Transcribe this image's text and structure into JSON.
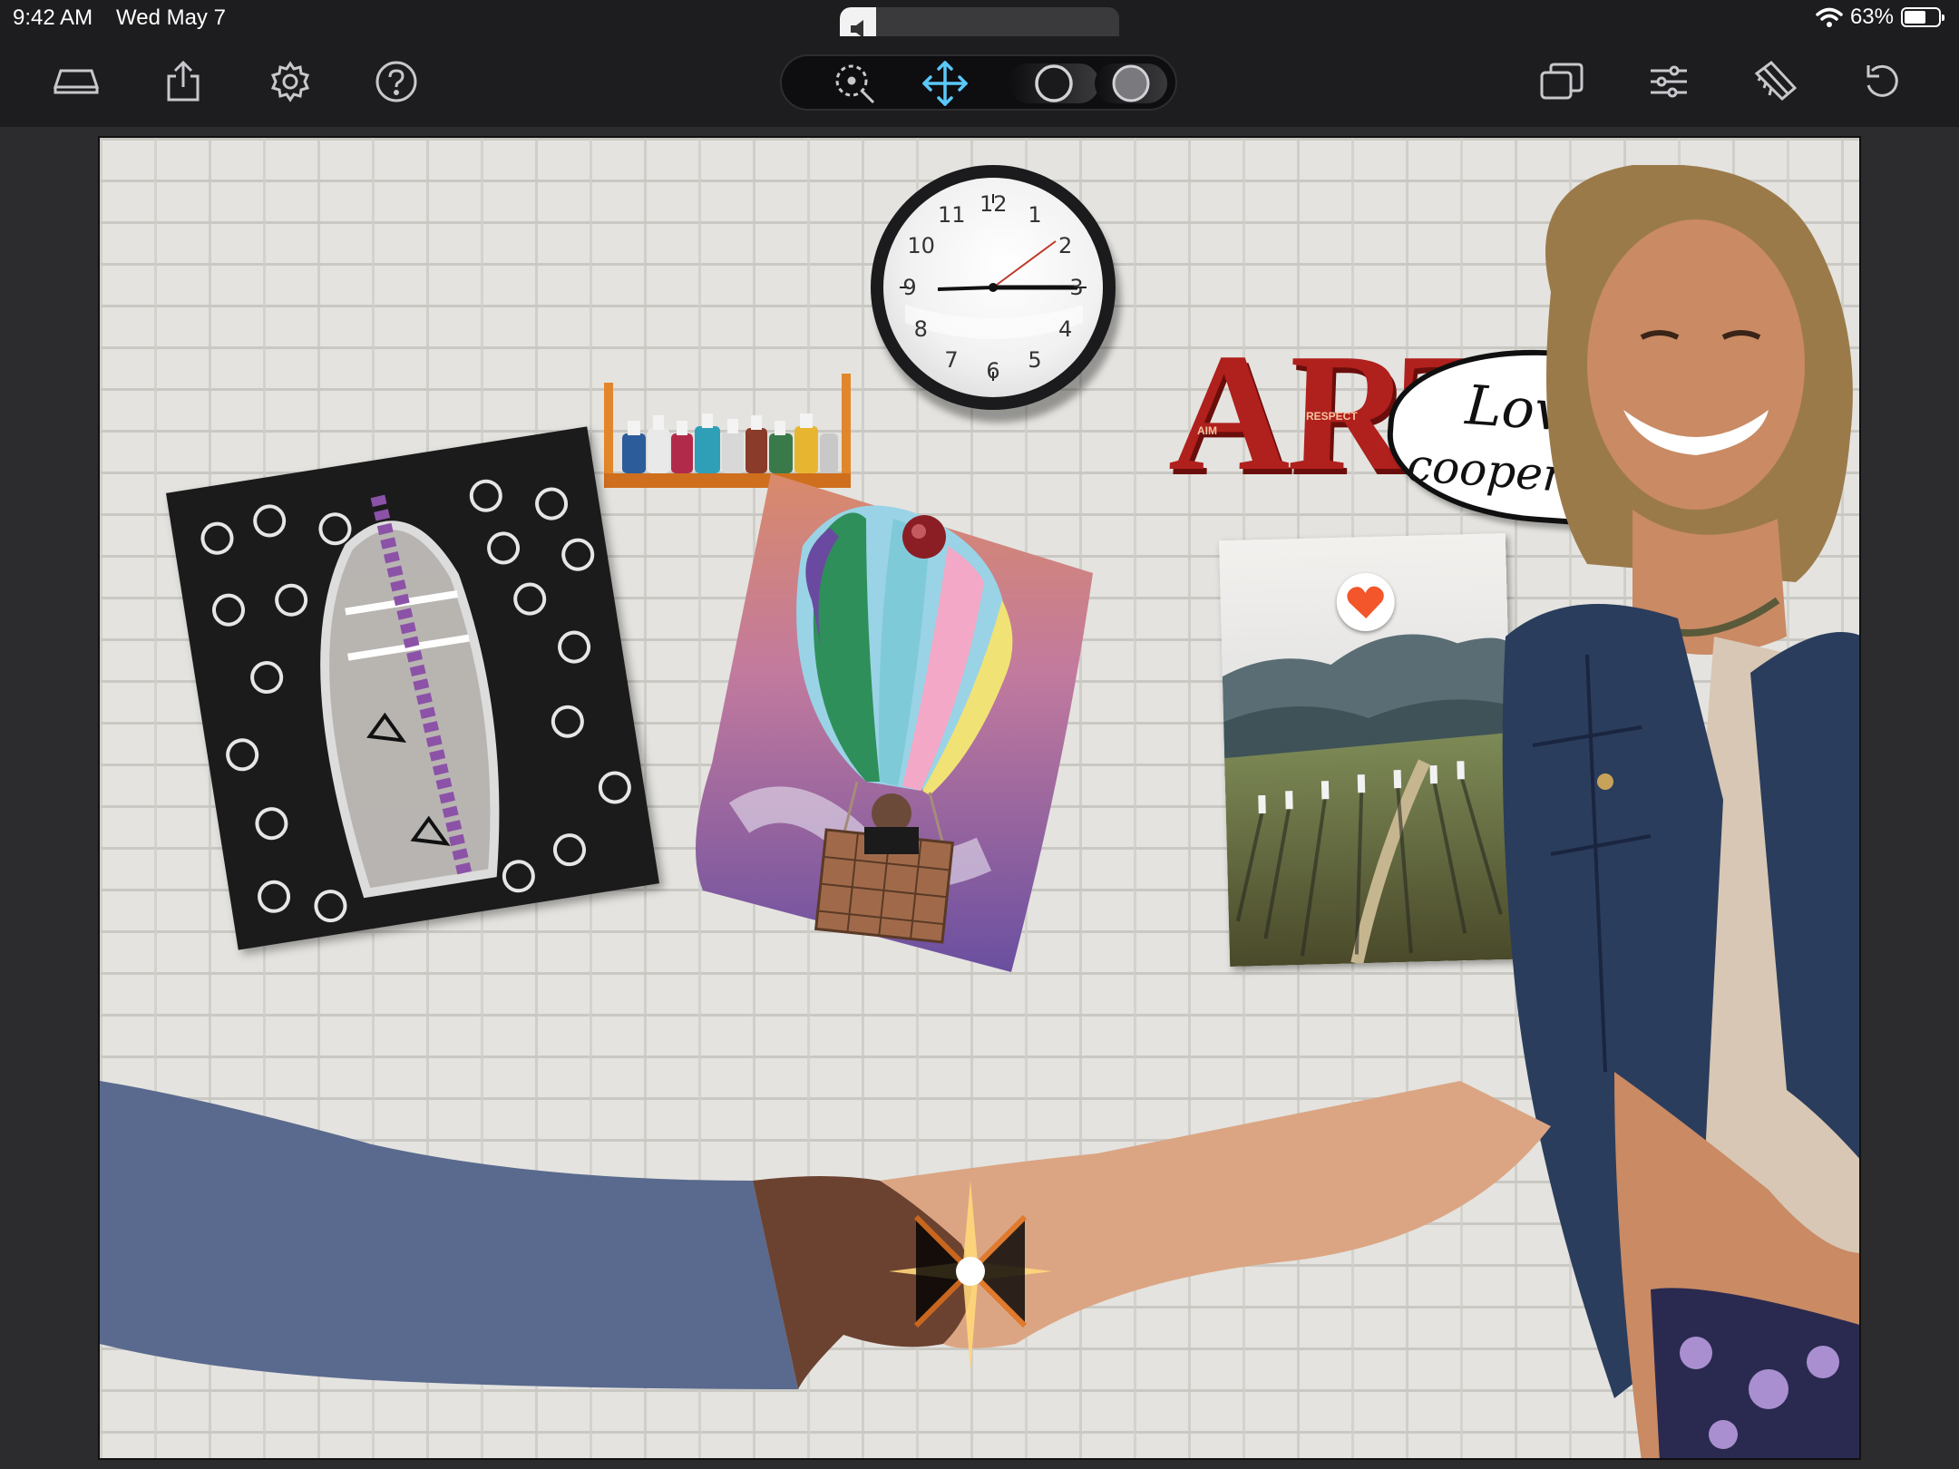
{
  "status_bar": {
    "time": "9:42 AM",
    "date": "Wed May 7",
    "battery_text": "63%",
    "battery_level": 0.63,
    "volume_level": 0.13
  },
  "toolbar": {
    "left_tools": [
      {
        "name": "layers-icon"
      },
      {
        "name": "share-icon"
      },
      {
        "name": "settings-icon"
      },
      {
        "name": "help-icon"
      }
    ],
    "center_tools": [
      {
        "name": "zoom-select-icon"
      },
      {
        "name": "move-icon",
        "active": true
      },
      {
        "name": "brush-size-icon"
      },
      {
        "name": "brush-opacity-icon"
      }
    ],
    "right_tools": [
      {
        "name": "duplicate-icon"
      },
      {
        "name": "adjustments-icon"
      },
      {
        "name": "eraser-icon"
      },
      {
        "name": "undo-icon"
      }
    ],
    "accent_color": "#5ac8fa"
  },
  "canvas": {
    "clock_numbers": [
      "12",
      "1",
      "2",
      "3",
      "4",
      "5",
      "6",
      "7",
      "8",
      "9",
      "10",
      "11"
    ],
    "art_word": "ART",
    "art_small_words": [
      "AIM",
      "RESPECT"
    ],
    "note_line1": "Love you",
    "note_line2": "cooperation!",
    "colors": {
      "wall": "#e4e3df",
      "art_red": "#b0201d",
      "heart": "#f2562a",
      "jacket": "#2b3d5c",
      "sleeve_left": "#5a6a8e"
    }
  }
}
